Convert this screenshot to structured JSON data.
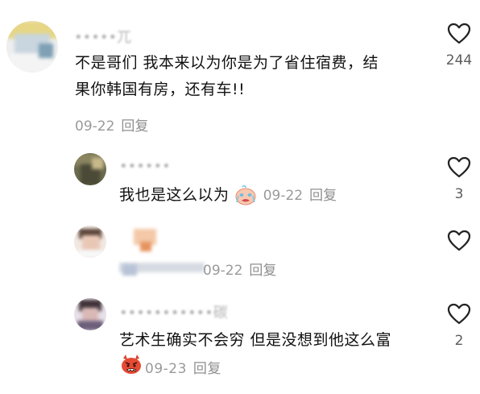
{
  "comments": [
    {
      "username": "•••••兀",
      "text": "不是哥们 我本来以为你是为了省住宿费，结果你韩国有房，还有车!!",
      "date": "09-22",
      "reply_label": "回复",
      "likes": "244",
      "avatar_colors": [
        "#e3d88d",
        "#b7c7d6",
        "#f2f2f2"
      ]
    }
  ],
  "replies": [
    {
      "username": "••••••",
      "text": "我也是这么以为",
      "emoji": "crying-face-emoji",
      "date": "09-22",
      "reply_label": "回复",
      "likes": "3"
    },
    {
      "username": "",
      "text": "",
      "date": "09-22",
      "reply_label": "回复",
      "likes": ""
    },
    {
      "username": "•••••••••••碳",
      "text": "艺术生确实不会穷 但是没想到他这么富",
      "emoji": "angry-devil-emoji",
      "date": "09-23",
      "reply_label": "回复",
      "likes": "2"
    }
  ]
}
